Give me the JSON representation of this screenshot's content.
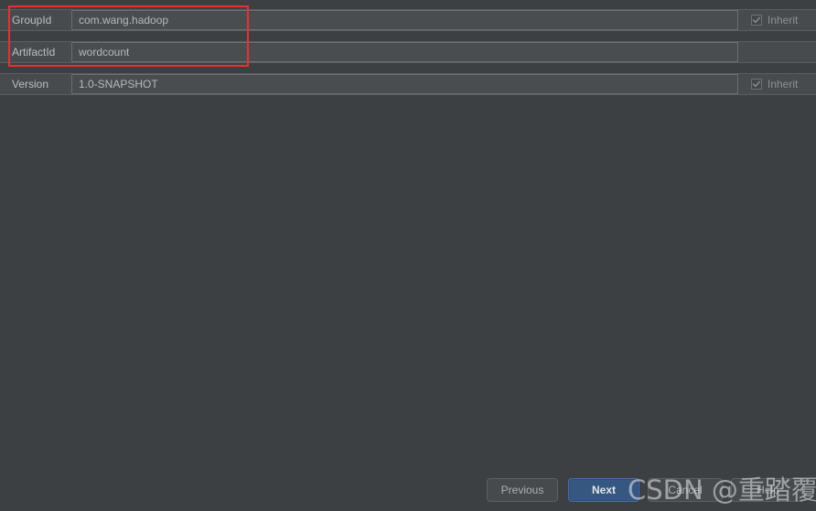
{
  "dialog": {
    "theme_background": "#3c4043",
    "accent_color": "#365880",
    "annotation_color": "#ef2d2d"
  },
  "form": {
    "rows": [
      {
        "label": "GroupId",
        "value": "com.wang.hadoop",
        "inherit_label": "Inherit",
        "inherit_checked": true,
        "has_inherit": true
      },
      {
        "label": "ArtifactId",
        "value": "wordcount",
        "inherit_label": "",
        "inherit_checked": false,
        "has_inherit": false
      },
      {
        "label": "Version",
        "value": "1.0-SNAPSHOT",
        "inherit_label": "Inherit",
        "inherit_checked": true,
        "has_inherit": true
      }
    ]
  },
  "buttons": {
    "previous": "Previous",
    "next": "Next",
    "cancel": "Cancel",
    "help": "Help"
  },
  "watermark": {
    "text": "CSDN @重踏覆辙的我"
  }
}
